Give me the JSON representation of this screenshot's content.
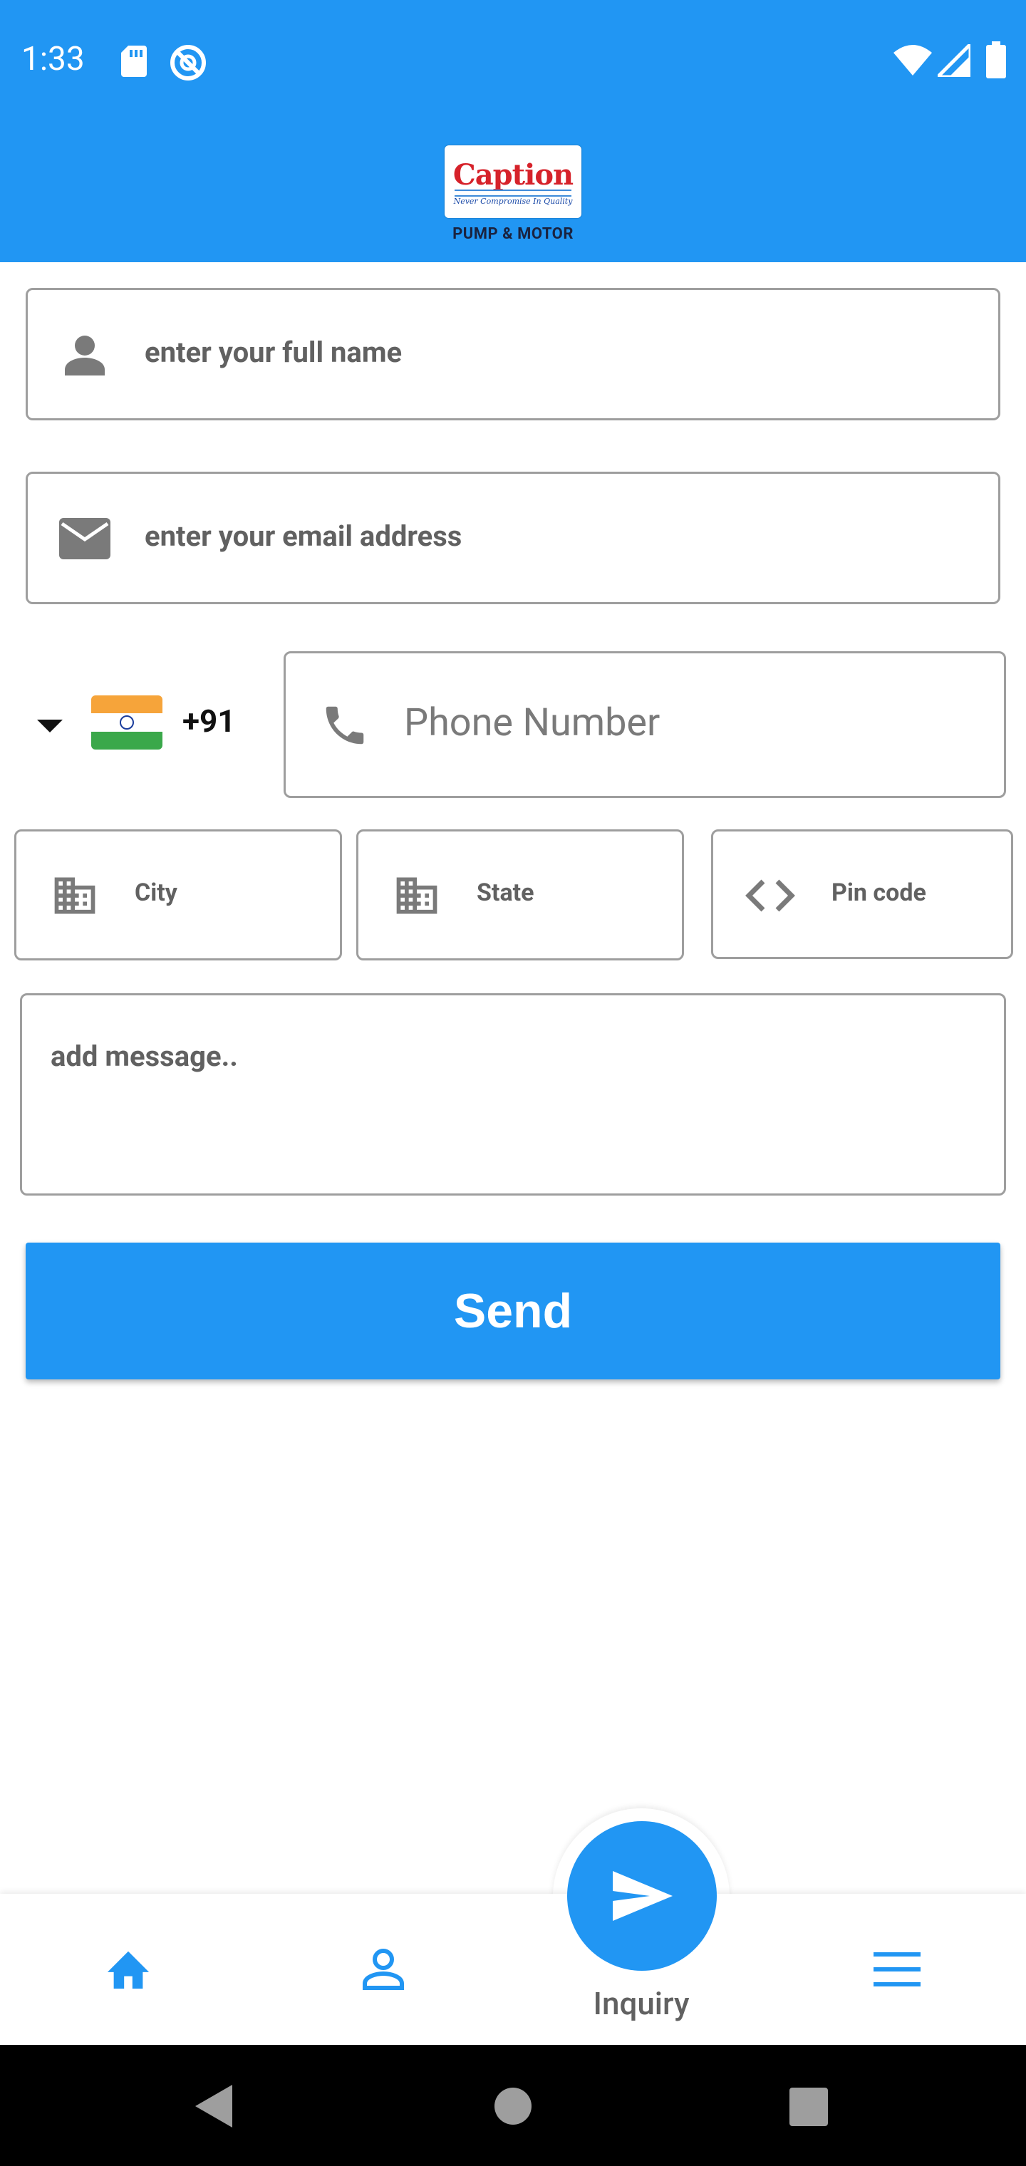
{
  "status_bar": {
    "time": "1:33",
    "icons": [
      "sd-card-icon",
      "sync-disabled-icon",
      "wifi-icon",
      "cell-signal-icon",
      "battery-icon"
    ]
  },
  "header": {
    "logo_text": "Caption",
    "logo_tagline": "Never Compromise In Quality",
    "logo_subtitle": "PUMP & MOTOR",
    "background_color": "#2196f3"
  },
  "form": {
    "name_placeholder": "enter your full name",
    "email_placeholder": "enter your email address",
    "country_code": "+91",
    "country_flag": "india-flag-icon",
    "phone_placeholder": "Phone Number",
    "city_placeholder": "City",
    "state_placeholder": "State",
    "pincode_placeholder": "Pin code",
    "message_placeholder": "add message..",
    "send_label": "Send",
    "accent_color": "#2196f3"
  },
  "bottom_nav": {
    "items": [
      {
        "name": "home",
        "icon": "home-icon"
      },
      {
        "name": "profile",
        "icon": "person-icon"
      },
      {
        "name": "inquiry",
        "icon": "send-icon",
        "label": "Inquiry"
      },
      {
        "name": "menu",
        "icon": "menu-icon"
      }
    ],
    "active_label": "Inquiry"
  },
  "system_nav": {
    "buttons": [
      "back-icon",
      "home-circle-icon",
      "recents-icon"
    ]
  }
}
